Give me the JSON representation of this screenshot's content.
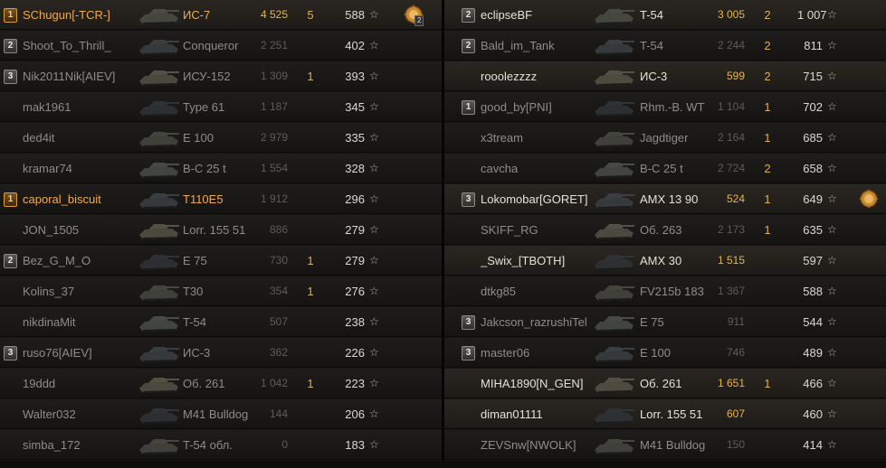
{
  "left_team": [
    {
      "platoon": "1",
      "name": "SChugun[-TCR-]",
      "vehicle": "ИС-7",
      "damage": "4 525",
      "kills": "5",
      "points": "588",
      "me": true,
      "highlight": true,
      "medal": "ace-medal-icon",
      "medal_count": "2"
    },
    {
      "platoon": "2",
      "name": "Shoot_To_Thrill_",
      "vehicle": "Conqueror",
      "damage": "2 251",
      "kills": "",
      "points": "402"
    },
    {
      "platoon": "3",
      "name": "Nik2011Nik[AIEV]",
      "vehicle": "ИСУ-152",
      "damage": "1 309",
      "kills": "1",
      "points": "393"
    },
    {
      "platoon": "",
      "name": "mak1961",
      "vehicle": "Type 61",
      "damage": "1 187",
      "kills": "",
      "points": "345"
    },
    {
      "platoon": "",
      "name": "ded4it",
      "vehicle": "E 100",
      "damage": "2 979",
      "kills": "",
      "points": "335"
    },
    {
      "platoon": "",
      "name": "kramar74",
      "vehicle": "B-C 25 t",
      "damage": "1 554",
      "kills": "",
      "points": "328"
    },
    {
      "platoon": "1",
      "name": "caporal_biscuit",
      "vehicle": "T110E5",
      "damage": "1 912",
      "kills": "",
      "points": "296",
      "me": true
    },
    {
      "platoon": "",
      "name": "JON_1505",
      "vehicle": "Lorr. 155 51",
      "damage": "886",
      "kills": "",
      "points": "279"
    },
    {
      "platoon": "2",
      "name": "Bez_G_M_O",
      "vehicle": "E 75",
      "damage": "730",
      "kills": "1",
      "points": "279"
    },
    {
      "platoon": "",
      "name": "Kolins_37",
      "vehicle": "T30",
      "damage": "354",
      "kills": "1",
      "points": "276"
    },
    {
      "platoon": "",
      "name": "nikdinaMit",
      "vehicle": "T-54",
      "damage": "507",
      "kills": "",
      "points": "238"
    },
    {
      "platoon": "3",
      "name": "ruso76[AIEV]",
      "vehicle": "ИС-3",
      "damage": "362",
      "kills": "",
      "points": "226"
    },
    {
      "platoon": "",
      "name": "19ddd",
      "vehicle": "Об. 261",
      "damage": "1 042",
      "kills": "1",
      "points": "223"
    },
    {
      "platoon": "",
      "name": "Walter032",
      "vehicle": "M41 Bulldog",
      "damage": "144",
      "kills": "",
      "points": "206"
    },
    {
      "platoon": "",
      "name": "simba_172",
      "vehicle": "T-54 обл.",
      "damage": "0",
      "kills": "",
      "points": "183"
    }
  ],
  "right_team": [
    {
      "platoon": "2",
      "name": "eclipseBF",
      "vehicle": "T-54",
      "damage": "3 005",
      "kills": "2",
      "points": "1 007",
      "highlight": true
    },
    {
      "platoon": "2",
      "name": "Bald_im_Tank",
      "vehicle": "T-54",
      "damage": "2 244",
      "kills": "2",
      "points": "811"
    },
    {
      "platoon": "",
      "name": "rooolezzzz",
      "vehicle": "ИС-3",
      "damage": "599",
      "kills": "2",
      "points": "715",
      "highlight": true
    },
    {
      "platoon": "1",
      "name": "good_by[PNI]",
      "vehicle": "Rhm.-B. WT",
      "damage": "1 104",
      "kills": "1",
      "points": "702"
    },
    {
      "platoon": "",
      "name": "x3tream",
      "vehicle": "Jagdtiger",
      "damage": "2 164",
      "kills": "1",
      "points": "685"
    },
    {
      "platoon": "",
      "name": "cavcha",
      "vehicle": "B-C 25 t",
      "damage": "2 724",
      "kills": "2",
      "points": "658"
    },
    {
      "platoon": "3",
      "name": "Lokomobar[GORET]",
      "vehicle": "AMX 13 90",
      "damage": "524",
      "kills": "1",
      "points": "649",
      "highlight": true,
      "medal": "ace-medal-icon"
    },
    {
      "platoon": "",
      "name": "SKIFF_RG",
      "vehicle": "Об. 263",
      "damage": "2 173",
      "kills": "1",
      "points": "635"
    },
    {
      "platoon": "",
      "name": "_Swix_[TBOTH]",
      "vehicle": "AMX 30",
      "damage": "1 515",
      "kills": "",
      "points": "597",
      "highlight": true
    },
    {
      "platoon": "",
      "name": "dtkg85",
      "vehicle": "FV215b 183",
      "damage": "1 367",
      "kills": "",
      "points": "588"
    },
    {
      "platoon": "3",
      "name": "Jakcson_razrushiTel",
      "vehicle": "E 75",
      "damage": "911",
      "kills": "",
      "points": "544"
    },
    {
      "platoon": "3",
      "name": "master06",
      "vehicle": "E 100",
      "damage": "746",
      "kills": "",
      "points": "489"
    },
    {
      "platoon": "",
      "name": "MIHA1890[N_GEN]",
      "vehicle": "Об. 261",
      "damage": "1 651",
      "kills": "1",
      "points": "466",
      "highlight": true
    },
    {
      "platoon": "",
      "name": "diman01111",
      "vehicle": "Lorr. 155 51",
      "damage": "607",
      "kills": "",
      "points": "460",
      "highlight": true
    },
    {
      "platoon": "",
      "name": "ZEVSnw[NWOLK]",
      "vehicle": "M41 Bulldog",
      "damage": "150",
      "kills": "",
      "points": "414"
    }
  ],
  "icons": {
    "star": "☆",
    "tank": "tank-silhouette-icon",
    "platoon": "platoon-badge-icon"
  },
  "colors": {
    "self": "#f0a94f",
    "damage_alive": "#e6b54f",
    "kills": "#d9b257"
  }
}
